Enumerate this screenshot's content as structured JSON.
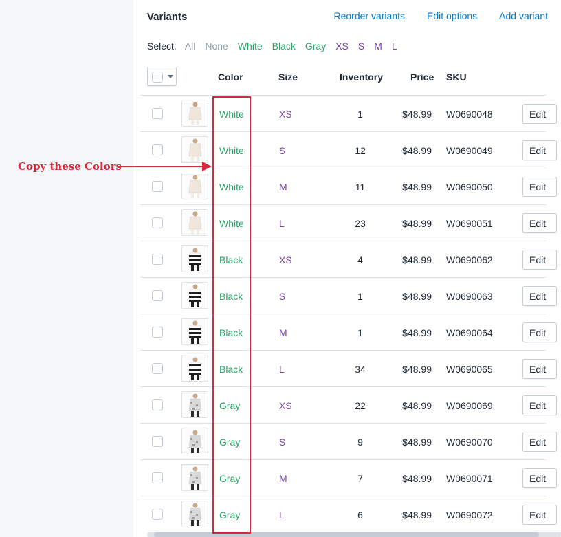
{
  "section": {
    "title": "Variants",
    "links": [
      "Reorder variants",
      "Edit options",
      "Add variant"
    ]
  },
  "select": {
    "label": "Select:",
    "options": [
      {
        "label": "All",
        "kind": "muted"
      },
      {
        "label": "None",
        "kind": "muted"
      },
      {
        "label": "White",
        "kind": "green"
      },
      {
        "label": "Black",
        "kind": "green"
      },
      {
        "label": "Gray",
        "kind": "green"
      },
      {
        "label": "XS",
        "kind": "purple"
      },
      {
        "label": "S",
        "kind": "purple"
      },
      {
        "label": "M",
        "kind": "purple"
      },
      {
        "label": "L",
        "kind": "purple"
      }
    ]
  },
  "columns": {
    "color": "Color",
    "size": "Size",
    "inventory": "Inventory",
    "price": "Price",
    "sku": "SKU"
  },
  "edit_label": "Edit",
  "rows": [
    {
      "color": "White",
      "size": "XS",
      "inventory": "1",
      "price": "$48.99",
      "sku": "W0690048"
    },
    {
      "color": "White",
      "size": "S",
      "inventory": "12",
      "price": "$48.99",
      "sku": "W0690049"
    },
    {
      "color": "White",
      "size": "M",
      "inventory": "11",
      "price": "$48.99",
      "sku": "W0690050"
    },
    {
      "color": "White",
      "size": "L",
      "inventory": "23",
      "price": "$48.99",
      "sku": "W0690051"
    },
    {
      "color": "Black",
      "size": "XS",
      "inventory": "4",
      "price": "$48.99",
      "sku": "W0690062"
    },
    {
      "color": "Black",
      "size": "S",
      "inventory": "1",
      "price": "$48.99",
      "sku": "W0690063"
    },
    {
      "color": "Black",
      "size": "M",
      "inventory": "1",
      "price": "$48.99",
      "sku": "W0690064"
    },
    {
      "color": "Black",
      "size": "L",
      "inventory": "34",
      "price": "$48.99",
      "sku": "W0690065"
    },
    {
      "color": "Gray",
      "size": "XS",
      "inventory": "22",
      "price": "$48.99",
      "sku": "W0690069"
    },
    {
      "color": "Gray",
      "size": "S",
      "inventory": "9",
      "price": "$48.99",
      "sku": "W0690070"
    },
    {
      "color": "Gray",
      "size": "M",
      "inventory": "7",
      "price": "$48.99",
      "sku": "W0690071"
    },
    {
      "color": "Gray",
      "size": "L",
      "inventory": "6",
      "price": "$48.99",
      "sku": "W0690072"
    }
  ],
  "annotation": {
    "text": "Copy these Colors",
    "color": "#d32a3c"
  },
  "colors": {
    "link": "#007ace",
    "option_green": "#29a368",
    "option_purple": "#7b3fb0"
  }
}
